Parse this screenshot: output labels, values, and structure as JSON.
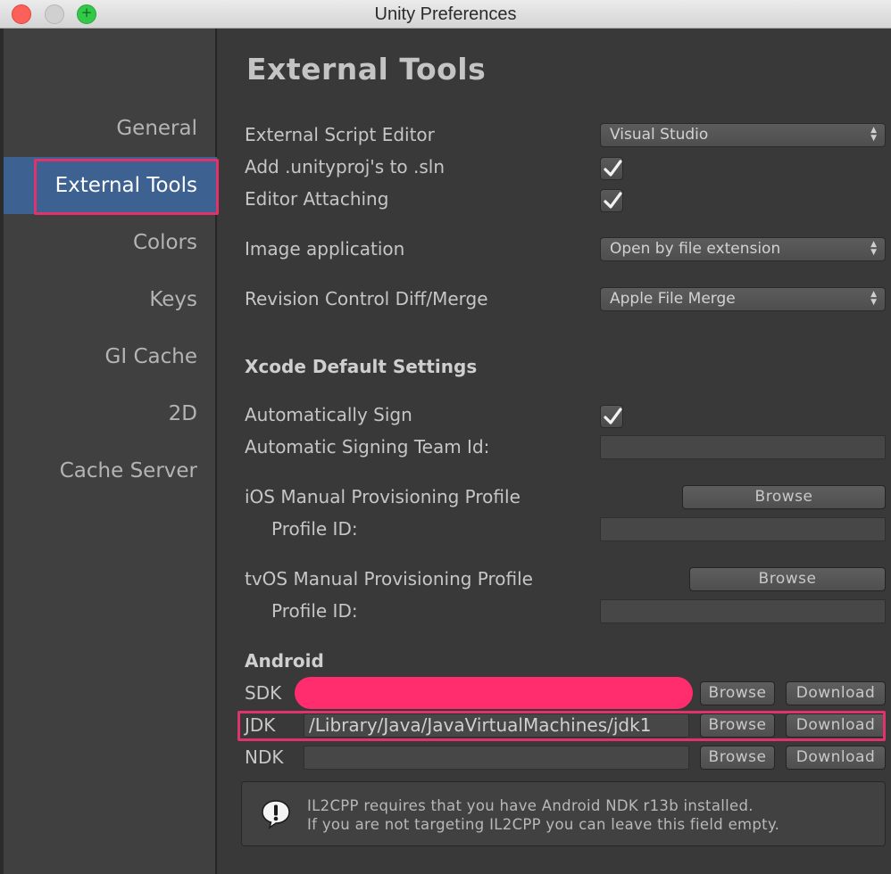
{
  "window": {
    "title": "Unity Preferences"
  },
  "sidebar": {
    "items": [
      {
        "label": "General"
      },
      {
        "label": "External Tools"
      },
      {
        "label": "Colors"
      },
      {
        "label": "Keys"
      },
      {
        "label": "GI Cache"
      },
      {
        "label": "2D"
      },
      {
        "label": "Cache Server"
      }
    ],
    "active": "External Tools"
  },
  "main": {
    "title": "External Tools",
    "script_editor": {
      "label": "External Script Editor",
      "value": "Visual Studio"
    },
    "add_unityproj": {
      "label": "Add .unityproj's to .sln",
      "checked": true
    },
    "editor_attaching": {
      "label": "Editor Attaching",
      "checked": true
    },
    "image_application": {
      "label": "Image application",
      "value": "Open by file extension"
    },
    "revision_control": {
      "label": "Revision Control Diff/Merge",
      "value": "Apple File Merge"
    },
    "xcode": {
      "title": "Xcode Default Settings",
      "auto_sign": {
        "label": "Automatically Sign",
        "checked": true
      },
      "team_id": {
        "label": "Automatic Signing Team Id:",
        "value": ""
      },
      "ios_profile": {
        "label": "iOS Manual Provisioning Profile",
        "browse": "Browse",
        "profile_id_label": "Profile ID:",
        "profile_id": ""
      },
      "tvos_profile": {
        "label": "tvOS Manual Provisioning Profile",
        "browse": "Browse",
        "profile_id_label": "Profile ID:",
        "profile_id": ""
      }
    },
    "android": {
      "title": "Android",
      "sdk": {
        "label": "SDK",
        "browse": "Browse",
        "download": "Download"
      },
      "jdk": {
        "label": "JDK",
        "value": "/Library/Java/JavaVirtualMachines/jdk1",
        "browse": "Browse",
        "download": "Download"
      },
      "ndk": {
        "label": "NDK",
        "value": "",
        "browse": "Browse",
        "download": "Download"
      },
      "help": {
        "line1": "IL2CPP requires that you have Android NDK r13b installed.",
        "line2": "If you are not targeting IL2CPP you can leave this field empty."
      }
    }
  },
  "colors": {
    "active_item": "#3d6191",
    "highlight": "#e0336e",
    "redaction": "#ff2d6d"
  },
  "icons": {
    "dropdown": "updown-arrows-icon",
    "check": "checkmark-icon",
    "help": "info-exclamation-icon"
  }
}
